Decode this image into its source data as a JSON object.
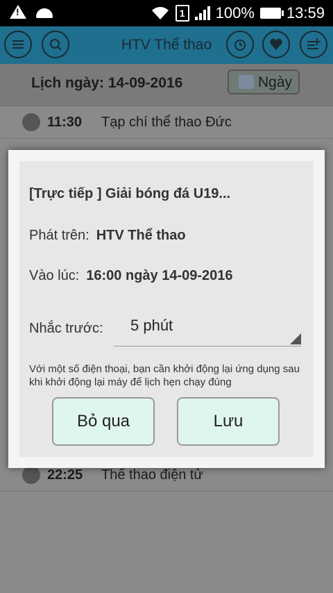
{
  "status_bar": {
    "battery": "100%",
    "time": "13:59",
    "sim_slot": "1"
  },
  "app_bar": {
    "title": "HTV Thể thao"
  },
  "schedule": {
    "date_label": "Lịch ngày:  14-09-2016",
    "view_button": "Ngày",
    "rows": [
      {
        "time": "11:30",
        "name": "Tạp chí thể thao Đức"
      },
      {
        "time": "22:25",
        "name": "Thể thao điện tử"
      }
    ]
  },
  "dialog": {
    "title": "[Trực tiếp ] Giải bóng đá U19...",
    "channel_label": "Phát trên:",
    "channel_value": "HTV Thể thao",
    "time_label": "Vào lúc:",
    "time_value": "16:00 ngày 14-09-2016",
    "reminder_label": "Nhắc trước:",
    "reminder_value": "5 phút",
    "note": "Với một số điện thoại, bạn cần khởi động lại ứng dụng sau khi khởi động lại máy để lịch hẹn chạy đúng",
    "cancel_button": "Bỏ qua",
    "save_button": "Lưu"
  }
}
